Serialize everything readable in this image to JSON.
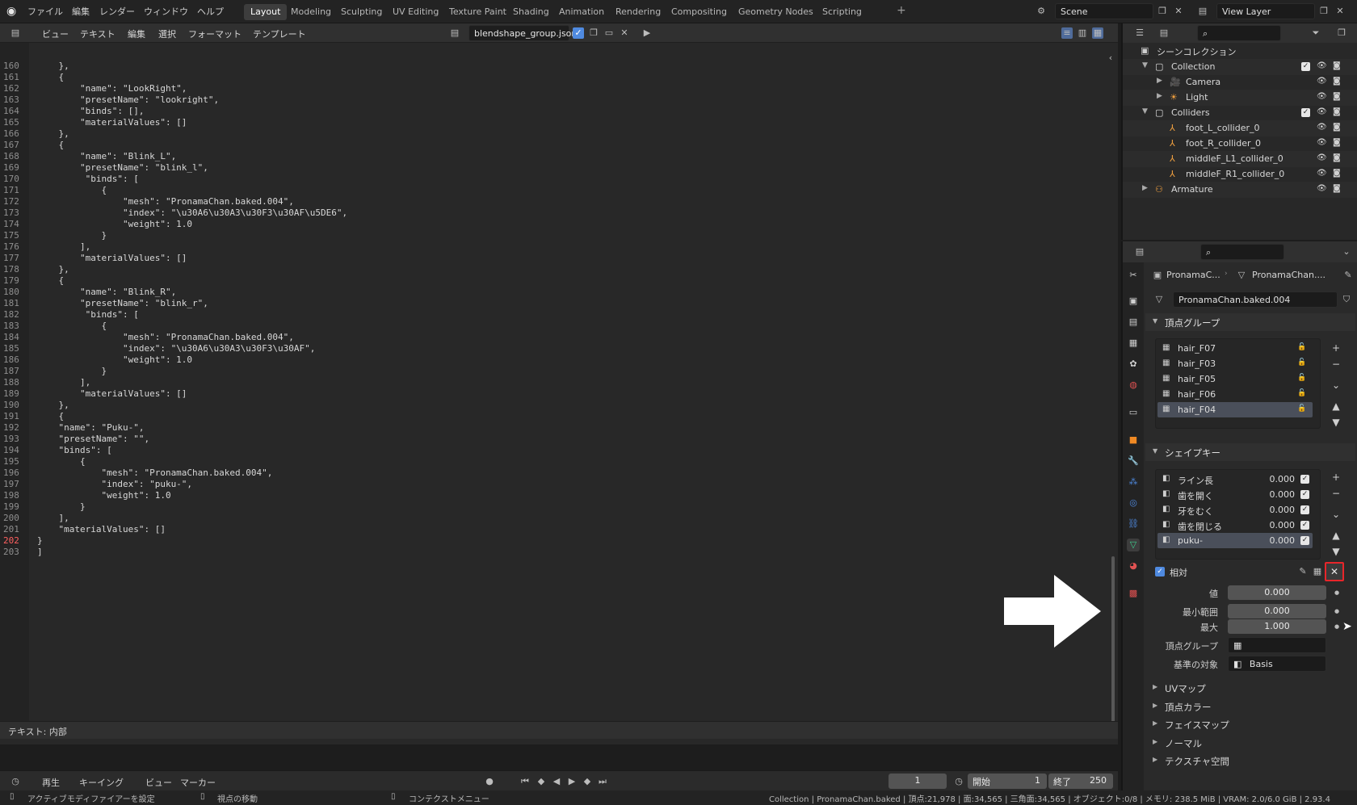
{
  "topbar": {
    "menus": [
      "ファイル",
      "編集",
      "レンダー",
      "ウィンドウ",
      "ヘルプ"
    ],
    "workspaces": [
      "Layout",
      "Modeling",
      "Sculpting",
      "UV Editing",
      "Texture Paint",
      "Shading",
      "Animation",
      "Rendering",
      "Compositing",
      "Geometry Nodes",
      "Scripting"
    ],
    "active_workspace": "Layout",
    "scene": "Scene",
    "view_layer": "View Layer"
  },
  "text_editor": {
    "menus": [
      "ビュー",
      "テキスト",
      "編集",
      "選択",
      "フォーマット",
      "テンプレート"
    ],
    "filename": "blendshape_group.json",
    "current_line": 202,
    "lines": [
      {
        "n": 160,
        "t": "    },"
      },
      {
        "n": 161,
        "t": "    {"
      },
      {
        "n": 162,
        "t": "        \"name\": \"LookRight\","
      },
      {
        "n": 163,
        "t": "        \"presetName\": \"lookright\","
      },
      {
        "n": 164,
        "t": "        \"binds\": [],"
      },
      {
        "n": 165,
        "t": "        \"materialValues\": []"
      },
      {
        "n": 166,
        "t": "    },"
      },
      {
        "n": 167,
        "t": "    {"
      },
      {
        "n": 168,
        "t": "        \"name\": \"Blink_L\","
      },
      {
        "n": 169,
        "t": "        \"presetName\": \"blink_l\","
      },
      {
        "n": 170,
        "t": "         \"binds\": ["
      },
      {
        "n": 171,
        "t": "            {"
      },
      {
        "n": 172,
        "t": "                \"mesh\": \"PronamaChan.baked.004\","
      },
      {
        "n": 173,
        "t": "                \"index\": \"\\u30A6\\u30A3\\u30F3\\u30AF\\u5DE6\","
      },
      {
        "n": 174,
        "t": "                \"weight\": 1.0"
      },
      {
        "n": 175,
        "t": "            }"
      },
      {
        "n": 176,
        "t": "        ],"
      },
      {
        "n": 177,
        "t": "        \"materialValues\": []"
      },
      {
        "n": 178,
        "t": "    },"
      },
      {
        "n": 179,
        "t": "    {"
      },
      {
        "n": 180,
        "t": "        \"name\": \"Blink_R\","
      },
      {
        "n": 181,
        "t": "        \"presetName\": \"blink_r\","
      },
      {
        "n": 182,
        "t": "         \"binds\": ["
      },
      {
        "n": 183,
        "t": "            {"
      },
      {
        "n": 184,
        "t": "                \"mesh\": \"PronamaChan.baked.004\","
      },
      {
        "n": 185,
        "t": "                \"index\": \"\\u30A6\\u30A3\\u30F3\\u30AF\","
      },
      {
        "n": 186,
        "t": "                \"weight\": 1.0"
      },
      {
        "n": 187,
        "t": "            }"
      },
      {
        "n": 188,
        "t": "        ],"
      },
      {
        "n": 189,
        "t": "        \"materialValues\": []"
      },
      {
        "n": 190,
        "t": "    },"
      },
      {
        "n": 191,
        "t": "    {"
      },
      {
        "n": 192,
        "t": "    \"name\": \"Puku-\","
      },
      {
        "n": 193,
        "t": "    \"presetName\": \"\","
      },
      {
        "n": 194,
        "t": "    \"binds\": ["
      },
      {
        "n": 195,
        "t": "        {"
      },
      {
        "n": 196,
        "t": "            \"mesh\": \"PronamaChan.baked.004\","
      },
      {
        "n": 197,
        "t": "            \"index\": \"puku-\","
      },
      {
        "n": 198,
        "t": "            \"weight\": 1.0"
      },
      {
        "n": 199,
        "t": "        }"
      },
      {
        "n": 200,
        "t": "    ],"
      },
      {
        "n": 201,
        "t": "    \"materialValues\": []"
      },
      {
        "n": 202,
        "t": "}"
      },
      {
        "n": 203,
        "t": "]"
      }
    ],
    "footer": "テキスト: 内部"
  },
  "timeline": {
    "play": "再生",
    "keying": "キーイング",
    "view": "ビュー",
    "marker": "マーカー",
    "frame": "1",
    "start_label": "開始",
    "start": "1",
    "end_label": "終了",
    "end": "250"
  },
  "statusbar": {
    "left1": "アクティブモディファイアーを設定",
    "left2": "視点の移動",
    "left3": "コンテクストメニュー",
    "right": "Collection | PronamaChan.baked | 頂点:21,978 | 面:34,565 | 三角面:34,565 | オブジェクト:0/8 | メモリ: 238.5 MiB | VRAM: 2.0/6.0 GiB | 2.93.4"
  },
  "outliner": {
    "scene_collection": "シーンコレクション",
    "rows": [
      {
        "label": "Collection",
        "depth": 1,
        "icon": "collection-icon",
        "expanded": true
      },
      {
        "label": "Camera",
        "depth": 2,
        "icon": "camera-icon",
        "expanded": false
      },
      {
        "label": "Light",
        "depth": 2,
        "icon": "light-icon",
        "expanded": false
      },
      {
        "label": "Colliders",
        "depth": 1,
        "icon": "collection-icon",
        "expanded": true
      },
      {
        "label": "foot_L_collider_0",
        "depth": 2,
        "icon": "empty-icon"
      },
      {
        "label": "foot_R_collider_0",
        "depth": 2,
        "icon": "empty-icon"
      },
      {
        "label": "middleF_L1_collider_0",
        "depth": 2,
        "icon": "empty-icon"
      },
      {
        "label": "middleF_R1_collider_0",
        "depth": 2,
        "icon": "empty-icon"
      },
      {
        "label": "Armature",
        "depth": 1,
        "icon": "armature-icon",
        "expanded": false
      }
    ]
  },
  "properties": {
    "breadcrumb_object": "PronamaC...",
    "breadcrumb_mesh": "PronamaChan....",
    "mesh_name": "PronamaChan.baked.004",
    "vertex_groups_title": "頂点グループ",
    "vertex_groups": [
      "hair_F07",
      "hair_F03",
      "hair_F05",
      "hair_F06",
      "hair_F04"
    ],
    "selected_vertex_group": "hair_F04",
    "shape_keys_title": "シェイプキー",
    "shape_keys": [
      {
        "name": "ライン長",
        "value": "0.000"
      },
      {
        "name": "歯を開く",
        "value": "0.000"
      },
      {
        "name": "牙をむく",
        "value": "0.000"
      },
      {
        "name": "歯を閉じる",
        "value": "0.000"
      },
      {
        "name": "puku-",
        "value": "0.000"
      }
    ],
    "selected_shape_key": "puku-",
    "relative_label": "相対",
    "value_label": "値",
    "value": "0.000",
    "range_min_label": "最小範囲",
    "range_min": "0.000",
    "max_label": "最大",
    "max": "1.000",
    "vertex_group_label": "頂点グループ",
    "relative_to_label": "基準の対象",
    "relative_to": "Basis",
    "collapsed_panels": [
      "UVマップ",
      "頂点カラー",
      "フェイスマップ",
      "ノーマル",
      "テクスチャ空間"
    ]
  },
  "colors": {
    "accent_selected": "#4a4f5a",
    "highlight_box": "#e8252a",
    "blue_icon": "#4f8ae0"
  }
}
